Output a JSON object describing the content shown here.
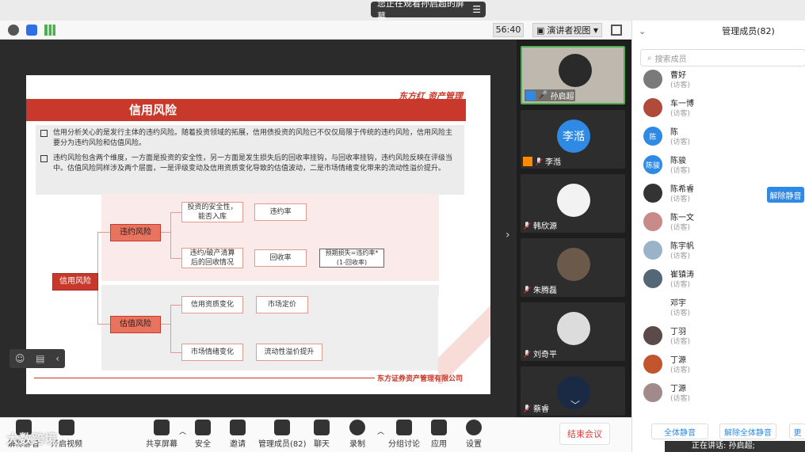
{
  "banner": {
    "text": "您正在观看孙启超的屏幕",
    "menu_icon": "list-icon"
  },
  "toolbar": {
    "timer": "56:40",
    "view_mode": "演讲者视图"
  },
  "slide": {
    "title": "信用风险",
    "brand": "东方红 资产管理",
    "para1": "信用分析关心的是发行主体的违约风险。随着投资领域的拓展，信用债投资的风险已不仅仅局限于传统的违约风险，信用风险主要分为违约风险和估值风险。",
    "para2": "违约风险包含两个维度，一方面是投资的安全性，另一方面是发生损失后的回收率挂钩，与回收率挂钩，违约风险反映在评级当中。估值风险同样涉及两个层面，一是评级变动及信用资质变化导致的估值波动，二是市场情绪变化带来的流动性溢价提升。",
    "root": "信用风险",
    "branch_default": "违约风险",
    "branch_valuation": "估值风险",
    "n_safety": "投资的安全性，能否入库",
    "n_default_rate": "违约率",
    "n_recovery_case": "违约/破产清算后的回收情况",
    "n_recovery_rate": "回收率",
    "n_expected_loss": "预期损失=违约率*(1-回收率)",
    "n_credit_change": "信用资质变化",
    "n_market_pricing": "市场定价",
    "n_sentiment": "市场情绪变化",
    "n_liquidity": "流动性溢价提升",
    "footer": "东方证券资产管理有限公司"
  },
  "strip": {
    "tiles": [
      {
        "name": "孙启超",
        "initials": ""
      },
      {
        "name": "李湉",
        "initials": "李湉"
      },
      {
        "name": "韩欣源",
        "initials": ""
      },
      {
        "name": "朱腾磊",
        "initials": ""
      },
      {
        "name": "刘奇平",
        "initials": ""
      },
      {
        "name": "蔡睿",
        "initials": ""
      }
    ]
  },
  "bottombar": {
    "mute": "解除静音",
    "video": "开启视频",
    "share": "共享屏幕",
    "security": "安全",
    "invite": "邀请",
    "members": "管理成员(82)",
    "chat": "聊天",
    "record": "录制",
    "breakout": "分组讨论",
    "apps": "应用",
    "settings": "设置",
    "end": "结束会议"
  },
  "panel": {
    "title": "管理成员(82)",
    "search_placeholder": "搜索成员",
    "members": [
      {
        "name": "曹好",
        "role": "(访客)",
        "initial": "",
        "color": "#7a7a7a"
      },
      {
        "name": "车一博",
        "role": "(访客)",
        "initial": "",
        "color": "#b04a3a"
      },
      {
        "name": "陈",
        "role": "(访客)",
        "initial": "陈",
        "color": "#2f8ae5"
      },
      {
        "name": "陈骏",
        "role": "(访客)",
        "initial": "陈骏",
        "color": "#2f8ae5"
      },
      {
        "name": "陈希睿",
        "role": "(访客)",
        "initial": "",
        "color": "#333333"
      },
      {
        "name": "陈一文",
        "role": "(访客)",
        "initial": "",
        "color": "#c98a8a"
      },
      {
        "name": "陈宇帆",
        "role": "(访客)",
        "initial": "",
        "color": "#9ab3c8"
      },
      {
        "name": "崔镇涛",
        "role": "(访客)",
        "initial": "",
        "color": "#556677"
      },
      {
        "name": "邓宇",
        "role": "(访客)",
        "initial": "",
        "color": "#ffffff"
      },
      {
        "name": "丁羽",
        "role": "(访客)",
        "initial": "",
        "color": "#5a4a4a"
      },
      {
        "name": "丁源",
        "role": "(访客)",
        "initial": "",
        "color": "#c2542e"
      },
      {
        "name": "丁源",
        "role": "(访客)",
        "initial": "",
        "color": "#a08a8a"
      }
    ],
    "unmute_button": "解除静音",
    "mute_all": "全体静音",
    "unmute_all": "解除全体静音",
    "more": "更",
    "speaking": "正在讲话: 孙启超;"
  },
  "watermark": "大数跨境"
}
